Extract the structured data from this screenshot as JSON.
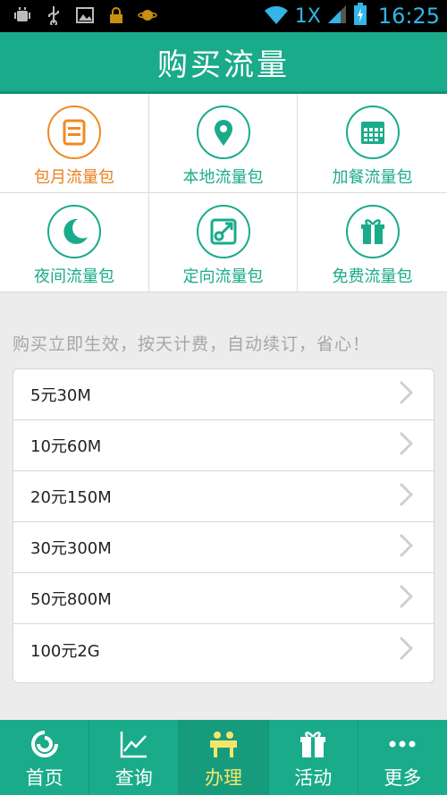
{
  "status_bar": {
    "network": "1X",
    "time": "16:25"
  },
  "header": {
    "title": "购买流量"
  },
  "categories": [
    {
      "label": "包月流量包",
      "icon": "calendar-month-icon",
      "color": "#e8811e"
    },
    {
      "label": "本地流量包",
      "icon": "location-pin-icon",
      "color": "#1aab8a"
    },
    {
      "label": "加餐流量包",
      "icon": "calendar-grid-icon",
      "color": "#1aab8a"
    },
    {
      "label": "夜间流量包",
      "icon": "moon-icon",
      "color": "#1aab8a"
    },
    {
      "label": "定向流量包",
      "icon": "target-arrow-icon",
      "color": "#1aab8a"
    },
    {
      "label": "免费流量包",
      "icon": "gift-icon",
      "color": "#1aab8a"
    }
  ],
  "note": "购买立即生效，按天计费，自动续订，省心！",
  "packages": [
    {
      "label": "5元30M"
    },
    {
      "label": "10元60M"
    },
    {
      "label": "20元150M"
    },
    {
      "label": "30元300M"
    },
    {
      "label": "50元800M"
    },
    {
      "label": "100元2G"
    }
  ],
  "bottom_nav": [
    {
      "label": "首页",
      "icon": "home-logo-icon"
    },
    {
      "label": "查询",
      "icon": "chart-icon"
    },
    {
      "label": "办理",
      "icon": "service-icon",
      "active": true
    },
    {
      "label": "活动",
      "icon": "gift-icon"
    },
    {
      "label": "更多",
      "icon": "more-dots-icon"
    }
  ],
  "colors": {
    "brand": "#1aab8a",
    "accent_orange": "#e8811e",
    "active_nav_text": "#f5e66a"
  }
}
